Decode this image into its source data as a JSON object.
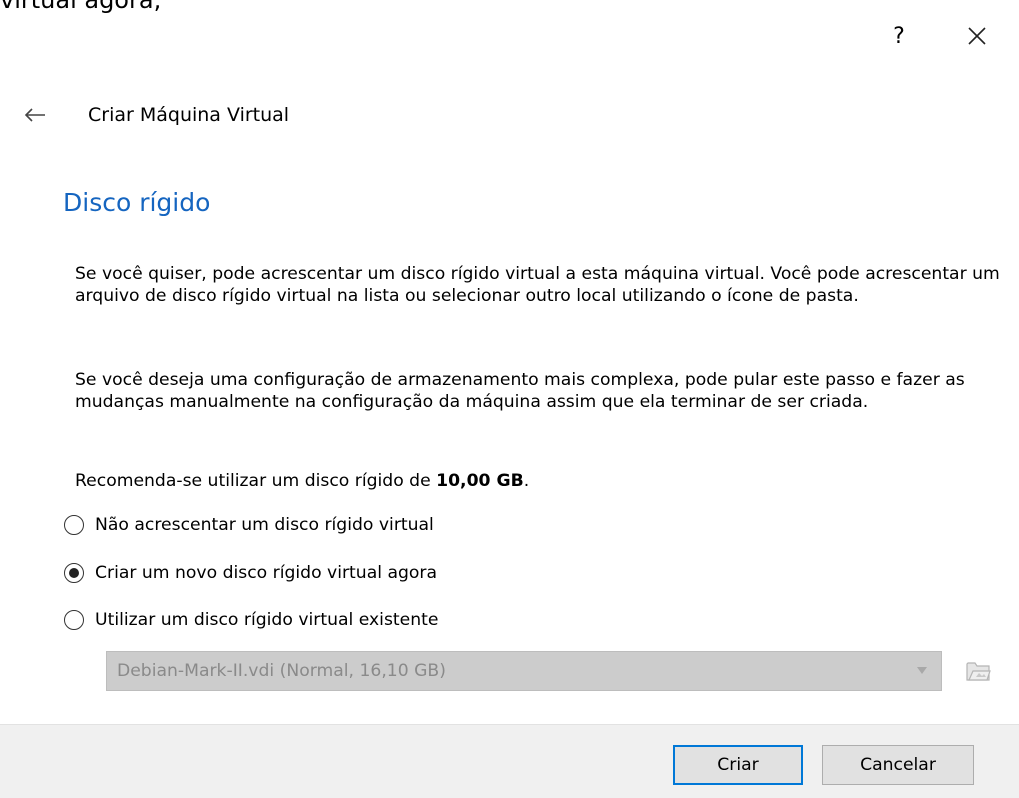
{
  "background_fragment": "virtual agora;",
  "window": {
    "help_label": "?",
    "close_icon": "close-icon"
  },
  "wizard": {
    "back_icon": "back-arrow-icon",
    "title": "Criar Máquina Virtual"
  },
  "page": {
    "heading": "Disco rígido",
    "paragraph1": "Se você quiser, pode acrescentar um disco rígido virtual a esta máquina virtual. Você pode acrescentar um arquivo de disco rígido virtual na lista ou selecionar outro local utilizando o ícone de pasta.",
    "paragraph2": "Se você deseja uma configuração de armazenamento mais complexa, pode pular este passo e fazer as mudanças manualmente na configuração da máquina assim que ela terminar de ser criada.",
    "recommendation_prefix": "Recomenda-se utilizar um disco rígido de ",
    "recommendation_size": "10,00 GB",
    "recommendation_suffix": "."
  },
  "options": [
    {
      "label": "Não acrescentar um disco rígido virtual",
      "selected": false
    },
    {
      "label": "Criar um novo disco rígido virtual agora",
      "selected": true
    },
    {
      "label": "Utilizar um disco rígido virtual existente",
      "selected": false
    }
  ],
  "disk_selector": {
    "value": "Debian-Mark-II.vdi (Normal, 16,10 GB)",
    "enabled": false,
    "folder_icon": "folder-open-icon"
  },
  "footer": {
    "create_label": "Criar",
    "cancel_label": "Cancelar"
  },
  "colors": {
    "heading": "#1565c0",
    "primary_border": "#0078d7",
    "disabled_bg": "#cccccc",
    "footer_bg": "#f0f0f0"
  }
}
